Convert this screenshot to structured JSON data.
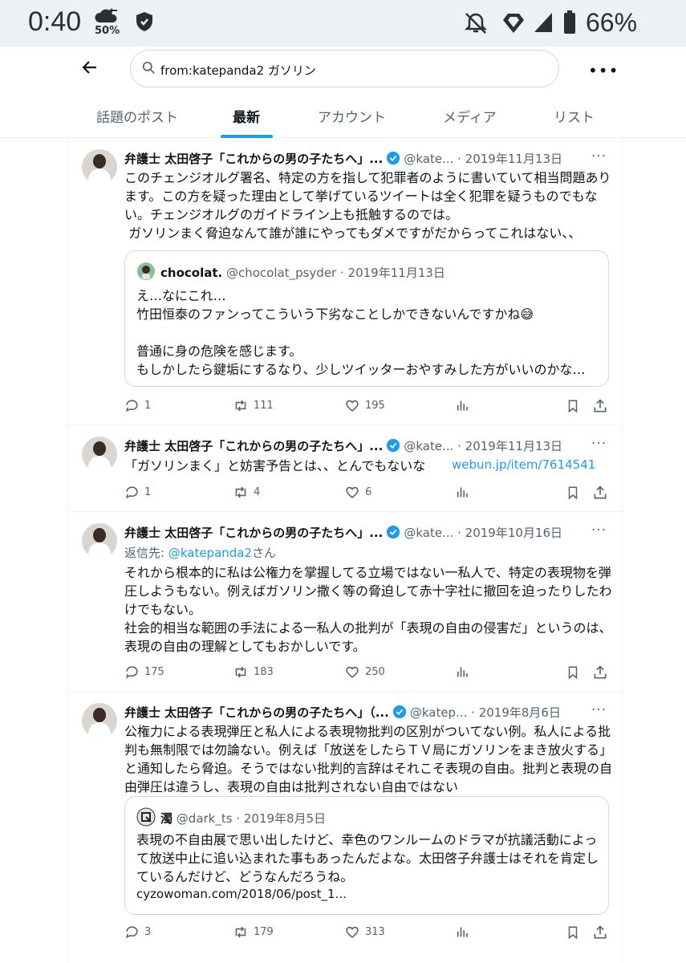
{
  "status_bar": {
    "time": "0:40",
    "data_saver_pct": "50%",
    "battery_pct": "66%"
  },
  "search": {
    "query": "from:katepanda2 ガソリン"
  },
  "tabs": [
    {
      "label": "話題のポスト"
    },
    {
      "label": "最新"
    },
    {
      "label": "アカウント"
    },
    {
      "label": "メディア"
    },
    {
      "label": "リスト"
    }
  ],
  "posts": [
    {
      "name": "弁護士 太田啓子「これからの男の子たちへ」...",
      "handle": "@kate...",
      "date": "· 2019年11月13日",
      "text": "このチェンジオルグ署名、特定の方を指して犯罪者のように書いていて相当問題あります。この方を疑った理由として挙げているツイートは全く犯罪を疑うものでもない。チェンジオルグのガイドライン上も抵触するのでは。\n ガソリンまく脅迫なんて誰が誰にやってもダメですがだからってこれはない、、",
      "quote": {
        "name": "chocolat.",
        "handle": "@chocolat_psyder",
        "date": "· 2019年11月13日",
        "text": "え…なにこれ…\n竹田恒泰のファンってこういう下劣なことしかできないんですかね😅\n\n普通に身の危険を感じます。\nもしかしたら鍵垢にするなり、少しツイッターおやすみした方がいいのかな…"
      },
      "replies": "1",
      "reposts": "111",
      "likes": "195"
    },
    {
      "name": "弁護士 太田啓子「これからの男の子たちへ」...",
      "handle": "@kate...",
      "date": "· 2019年11月13日",
      "text": "「ガソリンまく」と妨害予告とは、、とんでもないな",
      "link": "webun.jp/item/7614541",
      "replies": "1",
      "reposts": "4",
      "likes": "6"
    },
    {
      "name": "弁護士 太田啓子「これからの男の子たちへ」...",
      "handle": "@kate...",
      "date": "· 2019年10月16日",
      "reply_prefix": "返信先: ",
      "reply_to": "@katepanda2",
      "reply_suffix": "さん",
      "text": "それから根本的に私は公権力を掌握してる立場ではない一私人で、特定の表現物を弾圧しようもない。例えばガソリン撒く等の脅迫して赤十字社に撤回を迫ったりしたわけでもない。\n社会的相当な範囲の手法による一私人の批判が「表現の自由の侵害だ」というのは、表現の自由の理解としてもおかしいです。",
      "replies": "175",
      "reposts": "183",
      "likes": "250"
    },
    {
      "name": "弁護士 太田啓子「これからの男の子たちへ」（...",
      "handle": "@katep...",
      "date": "· 2019年8月6日",
      "text": "公権力による表現弾圧と私人による表現物批判の区別がついてない例。私人による批判も無制限では勿論ない。例えば「放送をしたらＴＶ局にガソリンをまき放火する」と通知したら脅迫。そうではない批判的言辞はそれこそ表現の自由。批判と表現の自由弾圧は違うし、表現の自由は批判されない自由ではない",
      "quote": {
        "name": "濁",
        "handle": "@dark_ts",
        "date": "· 2019年8月5日",
        "text": "表現の不自由展で思い出したけど、幸色のワンルームのドラマが抗議活動によって放送中止に追い込まれた事もあったんだよな。太田啓子弁護士はそれを肯定しているんだけど、どうなんだろうね。",
        "link": "cyzowoman.com/2018/06/post_1..."
      },
      "replies": "3",
      "reposts": "179",
      "likes": "313"
    }
  ]
}
